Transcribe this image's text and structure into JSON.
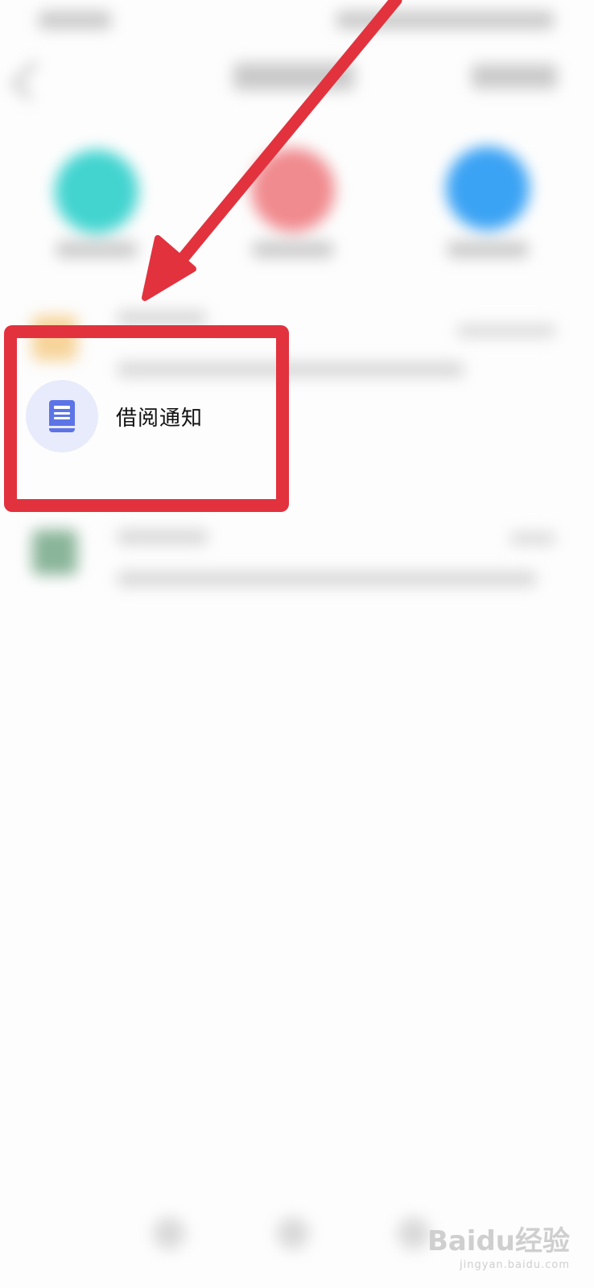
{
  "borrow_notice": {
    "label": "借阅通知",
    "icon": "book-icon",
    "icon_bg": "#e7ebfb",
    "icon_color": "#5d74e6"
  },
  "annotation": {
    "color": "#e2323e"
  },
  "watermark": {
    "brand": "Baidu经验",
    "url": "jingyan.baidu.com"
  }
}
